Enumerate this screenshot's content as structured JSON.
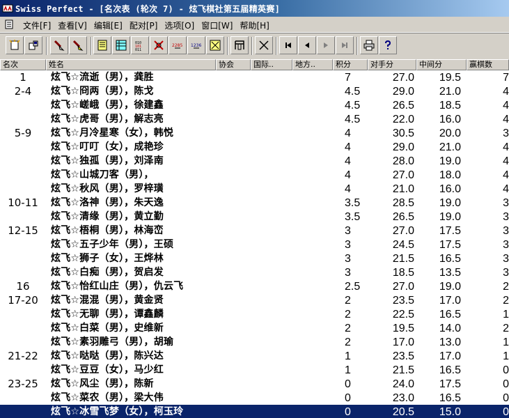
{
  "window": {
    "title": "Swiss Perfect - [名次表  (轮次 7) - 炫飞棋社第五届精英赛]"
  },
  "menu": {
    "items": [
      {
        "label": "文件[F]"
      },
      {
        "label": "查看[V]"
      },
      {
        "label": "编辑[E]"
      },
      {
        "label": "配对[P]"
      },
      {
        "label": "选项[O]"
      },
      {
        "label": "窗口[W]"
      },
      {
        "label": "帮助[H]"
      }
    ]
  },
  "toolbar": {
    "buttons": [
      {
        "icon": "new-tournament-icon"
      },
      {
        "icon": "open-tournament-icon"
      },
      {
        "icon": "add-player-icon"
      },
      {
        "icon": "edit-player-icon"
      },
      {
        "icon": "player-list-icon"
      },
      {
        "icon": "pairings-table-icon"
      },
      {
        "icon": "binary-results-icon"
      },
      {
        "icon": "withdraw-icon"
      },
      {
        "icon": "rating-2285-icon"
      },
      {
        "icon": "rating-1236-icon"
      },
      {
        "icon": "crosstable-icon"
      },
      {
        "icon": "round-icon"
      },
      {
        "icon": "scissors-icon"
      },
      {
        "icon": "first-icon"
      },
      {
        "icon": "previous-icon"
      },
      {
        "icon": "next-icon"
      },
      {
        "icon": "last-icon"
      },
      {
        "icon": "print-icon"
      },
      {
        "icon": "help-icon"
      }
    ],
    "counter_a": "2285",
    "counter_b": "1236"
  },
  "table": {
    "columns": [
      "名次",
      "姓名",
      "协会",
      "国际..",
      "地方..",
      "积分",
      "对手分",
      "中间分",
      "赢棋数"
    ],
    "rows": [
      {
        "rank": "1",
        "name": "炫飞☆流逝（男），龚胜",
        "score": "7",
        "opp": "27.0",
        "mid": "19.5",
        "wins": "7"
      },
      {
        "rank": "2-4",
        "name": "炫飞☆冏两（男），陈戈",
        "score": "4.5",
        "opp": "29.0",
        "mid": "21.0",
        "wins": "4"
      },
      {
        "rank": "",
        "name": "炫飞☆嵯峨（男），徐建鑫",
        "score": "4.5",
        "opp": "26.5",
        "mid": "18.5",
        "wins": "4"
      },
      {
        "rank": "",
        "name": "炫飞☆虎哥（男），解志亮",
        "score": "4.5",
        "opp": "22.0",
        "mid": "16.0",
        "wins": "4"
      },
      {
        "rank": "5-9",
        "name": "炫飞☆月冷星寒（女），韩悦",
        "score": "4",
        "opp": "30.5",
        "mid": "20.0",
        "wins": "3"
      },
      {
        "rank": "",
        "name": "炫飞☆叮叮（女），成艳珍",
        "score": "4",
        "opp": "29.0",
        "mid": "21.0",
        "wins": "4"
      },
      {
        "rank": "",
        "name": "炫飞☆独孤（男），刘泽南",
        "score": "4",
        "opp": "28.0",
        "mid": "19.0",
        "wins": "4"
      },
      {
        "rank": "",
        "name": "炫飞☆山城刀客（男），",
        "score": "4",
        "opp": "27.0",
        "mid": "18.0",
        "wins": "4"
      },
      {
        "rank": "",
        "name": "炫飞☆秋风（男），罗梓璜",
        "score": "4",
        "opp": "21.0",
        "mid": "16.0",
        "wins": "4"
      },
      {
        "rank": "10-11",
        "name": "炫飞☆洛神（男），朱天逸",
        "score": "3.5",
        "opp": "28.5",
        "mid": "19.0",
        "wins": "3"
      },
      {
        "rank": "",
        "name": "炫飞☆清缘（男），黄立勤",
        "score": "3.5",
        "opp": "26.5",
        "mid": "19.0",
        "wins": "3"
      },
      {
        "rank": "12-15",
        "name": "炫飞☆梧桐（男），林海峦",
        "score": "3",
        "opp": "27.0",
        "mid": "17.5",
        "wins": "3"
      },
      {
        "rank": "",
        "name": "炫飞☆五子少年（男），王硕",
        "score": "3",
        "opp": "24.5",
        "mid": "17.5",
        "wins": "3"
      },
      {
        "rank": "",
        "name": "炫飞☆狮子（女），王烨林",
        "score": "3",
        "opp": "21.5",
        "mid": "16.5",
        "wins": "3"
      },
      {
        "rank": "",
        "name": "炫飞☆白痴（男），贺启发",
        "score": "3",
        "opp": "18.5",
        "mid": "13.5",
        "wins": "3"
      },
      {
        "rank": "16",
        "name": "炫飞☆怡红山庄（男），仇云飞",
        "score": "2.5",
        "opp": "27.0",
        "mid": "19.0",
        "wins": "2"
      },
      {
        "rank": "17-20",
        "name": "炫飞☆混混（男），黄金贤",
        "score": "2",
        "opp": "23.5",
        "mid": "17.0",
        "wins": "2"
      },
      {
        "rank": "",
        "name": "炫飞☆无聊（男），谭鑫麟",
        "score": "2",
        "opp": "22.5",
        "mid": "16.5",
        "wins": "1"
      },
      {
        "rank": "",
        "name": "炫飞☆白菜（男），史维新",
        "score": "2",
        "opp": "19.5",
        "mid": "14.0",
        "wins": "2"
      },
      {
        "rank": "",
        "name": "炫飞☆素羽雕弓（男），胡瑜",
        "score": "2",
        "opp": "17.0",
        "mid": "13.0",
        "wins": "1"
      },
      {
        "rank": "21-22",
        "name": "炫飞☆哒哒（男），陈兴达",
        "score": "1",
        "opp": "23.5",
        "mid": "17.0",
        "wins": "1"
      },
      {
        "rank": "",
        "name": "炫飞☆豆豆（女），马少红",
        "score": "1",
        "opp": "21.5",
        "mid": "16.5",
        "wins": "0"
      },
      {
        "rank": "23-25",
        "name": "炫飞☆风尘（男），陈新",
        "score": "0",
        "opp": "24.0",
        "mid": "17.5",
        "wins": "0"
      },
      {
        "rank": "",
        "name": "炫飞☆菜农（男），梁大伟",
        "score": "0",
        "opp": "23.0",
        "mid": "16.5",
        "wins": "0"
      },
      {
        "rank": "",
        "name": "炫飞☆冰雪飞梦（女），柯玉玲",
        "score": "0",
        "opp": "20.5",
        "mid": "15.0",
        "wins": "0",
        "selected": true
      }
    ]
  },
  "colors": {
    "title_bar_start": "#0a246a",
    "title_bar_end": "#a6caf0",
    "chrome": "#d4d0c8",
    "selection": "#0a246a"
  }
}
